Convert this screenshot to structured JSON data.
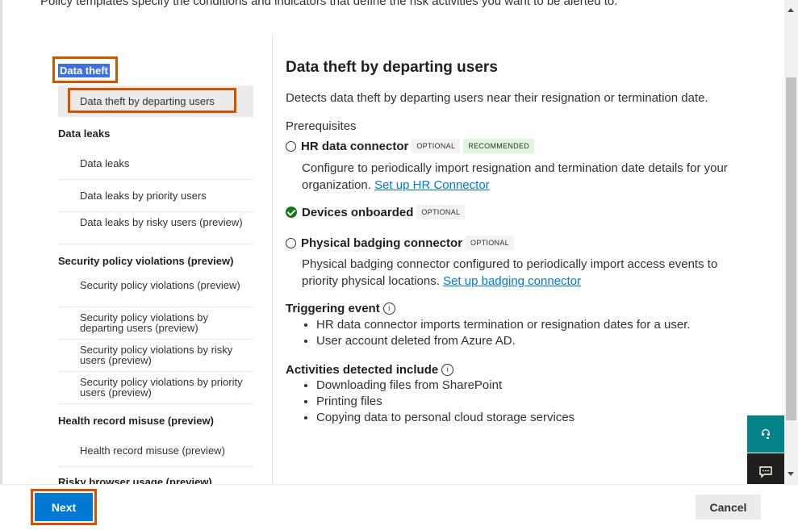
{
  "intro_text": "Policy templates specify the conditions and indicators that define the risk activities you want to be alerted to.",
  "nav": {
    "categories": [
      {
        "label": "Data theft"
      },
      {
        "label": "Data leaks"
      },
      {
        "label": "Security policy violations (preview)"
      },
      {
        "label": "Health record misuse (preview)"
      },
      {
        "label": "Risky browser usage (preview)"
      }
    ],
    "items": [
      {
        "label": "Data theft by departing users",
        "selected": true
      },
      {
        "label": "Data leaks"
      },
      {
        "label": "Data leaks by priority users"
      },
      {
        "label": "Data leaks by risky users (preview)"
      },
      {
        "label": "Security policy violations (preview)"
      },
      {
        "label": "Security policy violations by departing users (preview)"
      },
      {
        "label": "Security policy violations by risky users (preview)"
      },
      {
        "label": "Security policy violations by priority users (preview)"
      },
      {
        "label": "Health record misuse (preview)"
      }
    ]
  },
  "detail": {
    "title": "Data theft by departing users",
    "description": "Detects data theft by departing users near their resignation or termination date.",
    "prerequisites_label": "Prerequisites",
    "prereqs": [
      {
        "name": "HR data connector",
        "badges": [
          "OPTIONAL",
          "RECOMMENDED"
        ],
        "desc": "Configure to periodically import resignation and termination date details for your organization.",
        "link": "Set up HR Connector"
      },
      {
        "name": "Devices onboarded",
        "badges": [
          "OPTIONAL"
        ]
      },
      {
        "name": "Physical badging connector",
        "badges": [
          "OPTIONAL"
        ],
        "desc": "Physical badging connector configured to periodically import access events to priority physical locations.",
        "link": "Set up badging connector"
      }
    ],
    "triggering_label": "Triggering event",
    "triggering_items": [
      "HR data connector imports termination or resignation dates for a user.",
      "User account deleted from Azure AD."
    ],
    "activities_label": "Activities detected include",
    "activities_items": [
      "Downloading files from SharePoint",
      "Printing files",
      "Copying data to personal cloud storage services"
    ]
  },
  "footer": {
    "next_label": "Next",
    "cancel_label": "Cancel"
  },
  "colors": {
    "highlight": "#d35400",
    "primary": "#0078d4",
    "success": "#107c10"
  }
}
